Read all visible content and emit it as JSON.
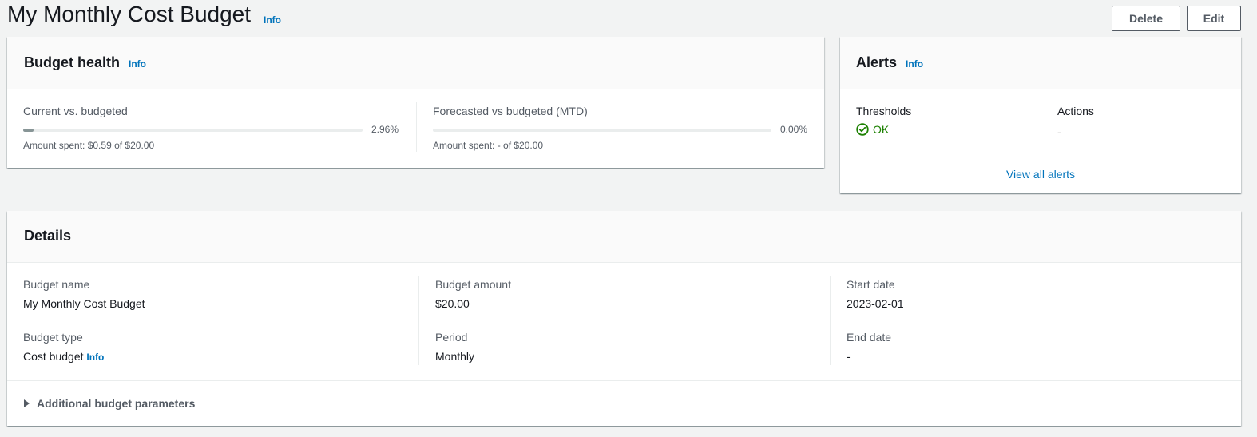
{
  "header": {
    "title": "My Monthly Cost Budget",
    "info": "Info",
    "delete_label": "Delete",
    "edit_label": "Edit"
  },
  "budget_health": {
    "title": "Budget health",
    "info": "Info",
    "current": {
      "label": "Current vs. budgeted",
      "percent_text": "2.96%",
      "percent_value": 2.96,
      "amount_text": "Amount spent: $0.59 of $20.00"
    },
    "forecasted": {
      "label": "Forecasted vs budgeted (MTD)",
      "percent_text": "0.00%",
      "percent_value": 0,
      "amount_text": "Amount spent: - of $20.00"
    }
  },
  "alerts": {
    "title": "Alerts",
    "info": "Info",
    "thresholds_label": "Thresholds",
    "thresholds_status": "OK",
    "actions_label": "Actions",
    "actions_value": "-",
    "view_all": "View all alerts",
    "status_color": "#1d8102",
    "status_icon": "check-circle-icon"
  },
  "details": {
    "title": "Details",
    "budget_name_label": "Budget name",
    "budget_name_value": "My Monthly Cost Budget",
    "budget_type_label": "Budget type",
    "budget_type_value": "Cost budget",
    "budget_type_info": "Info",
    "budget_amount_label": "Budget amount",
    "budget_amount_value": "$20.00",
    "period_label": "Period",
    "period_value": "Monthly",
    "start_date_label": "Start date",
    "start_date_value": "2023-02-01",
    "end_date_label": "End date",
    "end_date_value": "-",
    "additional_params": "Additional budget parameters"
  },
  "colors": {
    "link": "#0073bb",
    "progress_fill": "#879596",
    "ok_green": "#1d8102"
  }
}
